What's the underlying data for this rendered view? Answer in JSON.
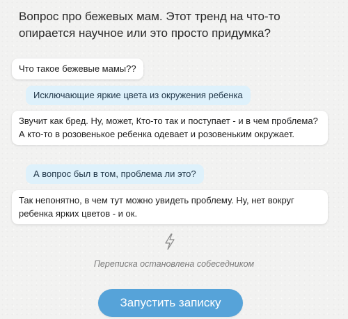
{
  "question": {
    "text": "Вопрос про бежевых мам. Этот тренд на что-то опирается научное или это просто придумка?"
  },
  "messages": [
    {
      "side": "white",
      "text": "Что такое бежевые мамы??"
    },
    {
      "side": "blue",
      "text": "Исключающие яркие цвета из окружения ребенка"
    },
    {
      "side": "white",
      "text": "Звучит как бред. Ну, может, Кто-то так и поступает - и в чем проблема? А кто-то в розовенькое ребенка одевает и розовеньким окружает."
    },
    {
      "side": "blue",
      "text": "А вопрос был в том, проблема ли это?"
    },
    {
      "side": "white",
      "text": "Так непонятно, в чем тут можно увидеть проблему. Ну, нет вокруг ребенка ярких цветов - и ок."
    }
  ],
  "status": {
    "icon": "lightning-icon",
    "text": "Переписка остановлена собеседником"
  },
  "action": {
    "start_label": "Запустить записку",
    "color": "#56a3d9"
  }
}
